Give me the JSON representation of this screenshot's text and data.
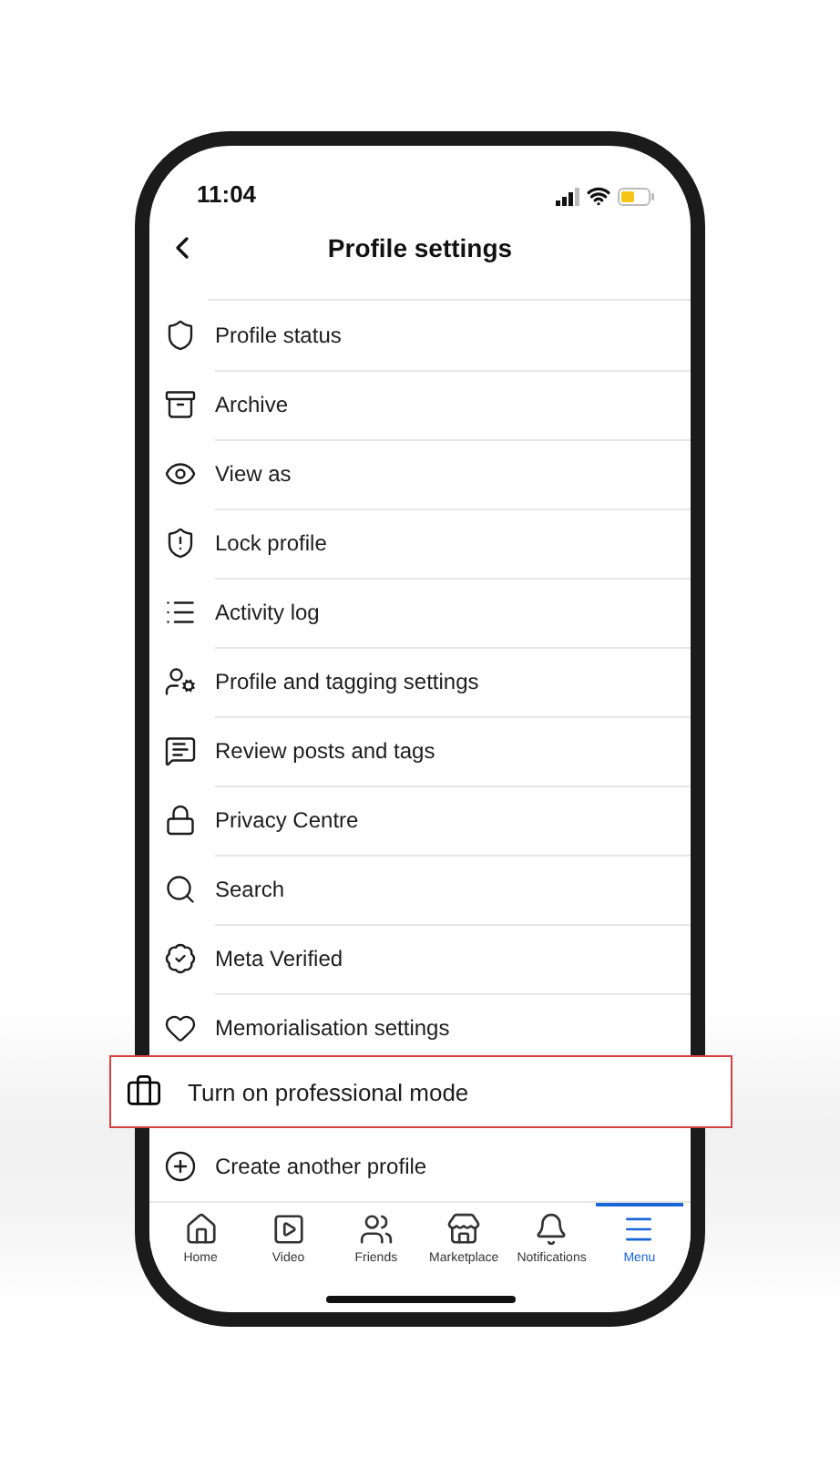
{
  "status_bar": {
    "time": "11:04"
  },
  "header": {
    "title": "Profile settings"
  },
  "items": [
    {
      "label": "Profile status"
    },
    {
      "label": "Archive"
    },
    {
      "label": "View as"
    },
    {
      "label": "Lock profile"
    },
    {
      "label": "Activity log"
    },
    {
      "label": "Profile and tagging settings"
    },
    {
      "label": "Review posts and tags"
    },
    {
      "label": "Privacy Centre"
    },
    {
      "label": "Search"
    },
    {
      "label": "Meta Verified"
    },
    {
      "label": "Memorialisation settings"
    },
    {
      "label": "Create another profile"
    }
  ],
  "highlight": {
    "label": "Turn on professional mode"
  },
  "tabs": [
    {
      "label": "Home",
      "selected": false
    },
    {
      "label": "Video",
      "selected": false
    },
    {
      "label": "Friends",
      "selected": false
    },
    {
      "label": "Marketplace",
      "selected": false
    },
    {
      "label": "Notifications",
      "selected": false
    },
    {
      "label": "Menu",
      "selected": true
    }
  ]
}
